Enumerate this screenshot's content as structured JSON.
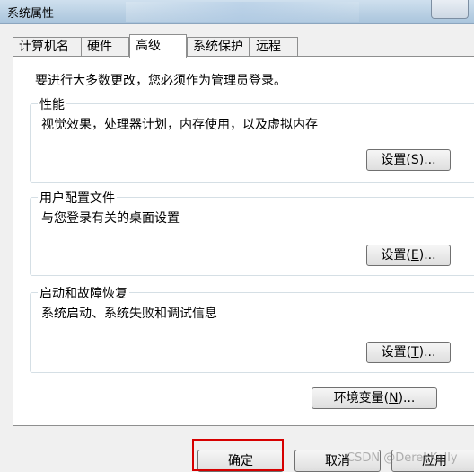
{
  "window": {
    "title": "系统属性"
  },
  "tabs": [
    "计算机名",
    "硬件",
    "高级",
    "系统保护",
    "远程"
  ],
  "active_tab": "高级",
  "intro": "要进行大多数更改，您必须作为管理员登录。",
  "groups": {
    "performance": {
      "title": "性能",
      "desc": "视觉效果，处理器计划，内存使用，以及虚拟内存",
      "btn_label": "设置",
      "btn_key": "S"
    },
    "profile": {
      "title": "用户配置文件",
      "desc": "与您登录有关的桌面设置",
      "btn_label": "设置",
      "btn_key": "E"
    },
    "startup": {
      "title": "启动和故障恢复",
      "desc": "系统启动、系统失败和调试信息",
      "btn_label": "设置",
      "btn_key": "T"
    }
  },
  "env_button": {
    "label": "环境变量",
    "key": "N"
  },
  "bottom": {
    "ok": "确定",
    "cancel": "取消",
    "apply": "应用"
  },
  "watermark": "CSDN @DerekKelly",
  "colors": {
    "highlight": "#d60000"
  }
}
